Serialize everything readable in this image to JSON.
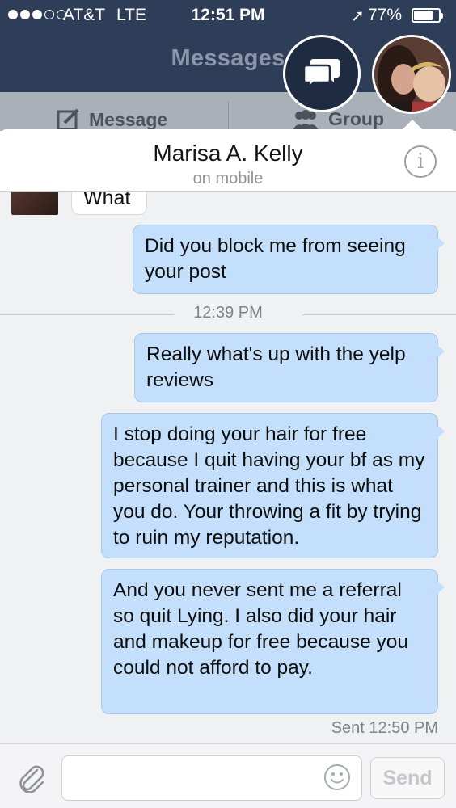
{
  "status_bar": {
    "carrier": "AT&T",
    "network": "LTE",
    "time": "12:51 PM",
    "battery": "77%",
    "battery_level": 0.77,
    "signal_bars": 3,
    "signal_total": 5
  },
  "nav": {
    "title": "Messages"
  },
  "actions": {
    "message_label": "Message",
    "group_label": "Group"
  },
  "conversation": {
    "contact_name": "Marisa A. Kelly",
    "contact_status": "on mobile",
    "incoming_partial": "What",
    "messages_before": [
      "Did you block me from seeing your post"
    ],
    "time_divider": "12:39 PM",
    "messages_after": [
      "Really what's up with the yelp reviews",
      "I stop doing your hair for free because I quit having your bf as my personal trainer and this is what you do.   Your throwing a fit by trying to ruin my reputation.",
      "And you never sent me a referral so quit Lying.   I also did your hair and makeup for free because you could not afford to pay."
    ],
    "sent_status": "Sent 12:50 PM"
  },
  "composer": {
    "placeholder": "",
    "send_label": "Send"
  },
  "colors": {
    "nav_bg": "#2e3d58",
    "bubble_out": "#c3dffb",
    "panel_bg": "#f0f1f3"
  },
  "icons": {
    "chat_heads": "chat-heads-icon",
    "compose": "compose-icon",
    "group": "group-icon",
    "info": "info-icon",
    "attach": "paperclip-icon",
    "emoji": "smiley-icon",
    "location": "location-arrow-icon"
  }
}
